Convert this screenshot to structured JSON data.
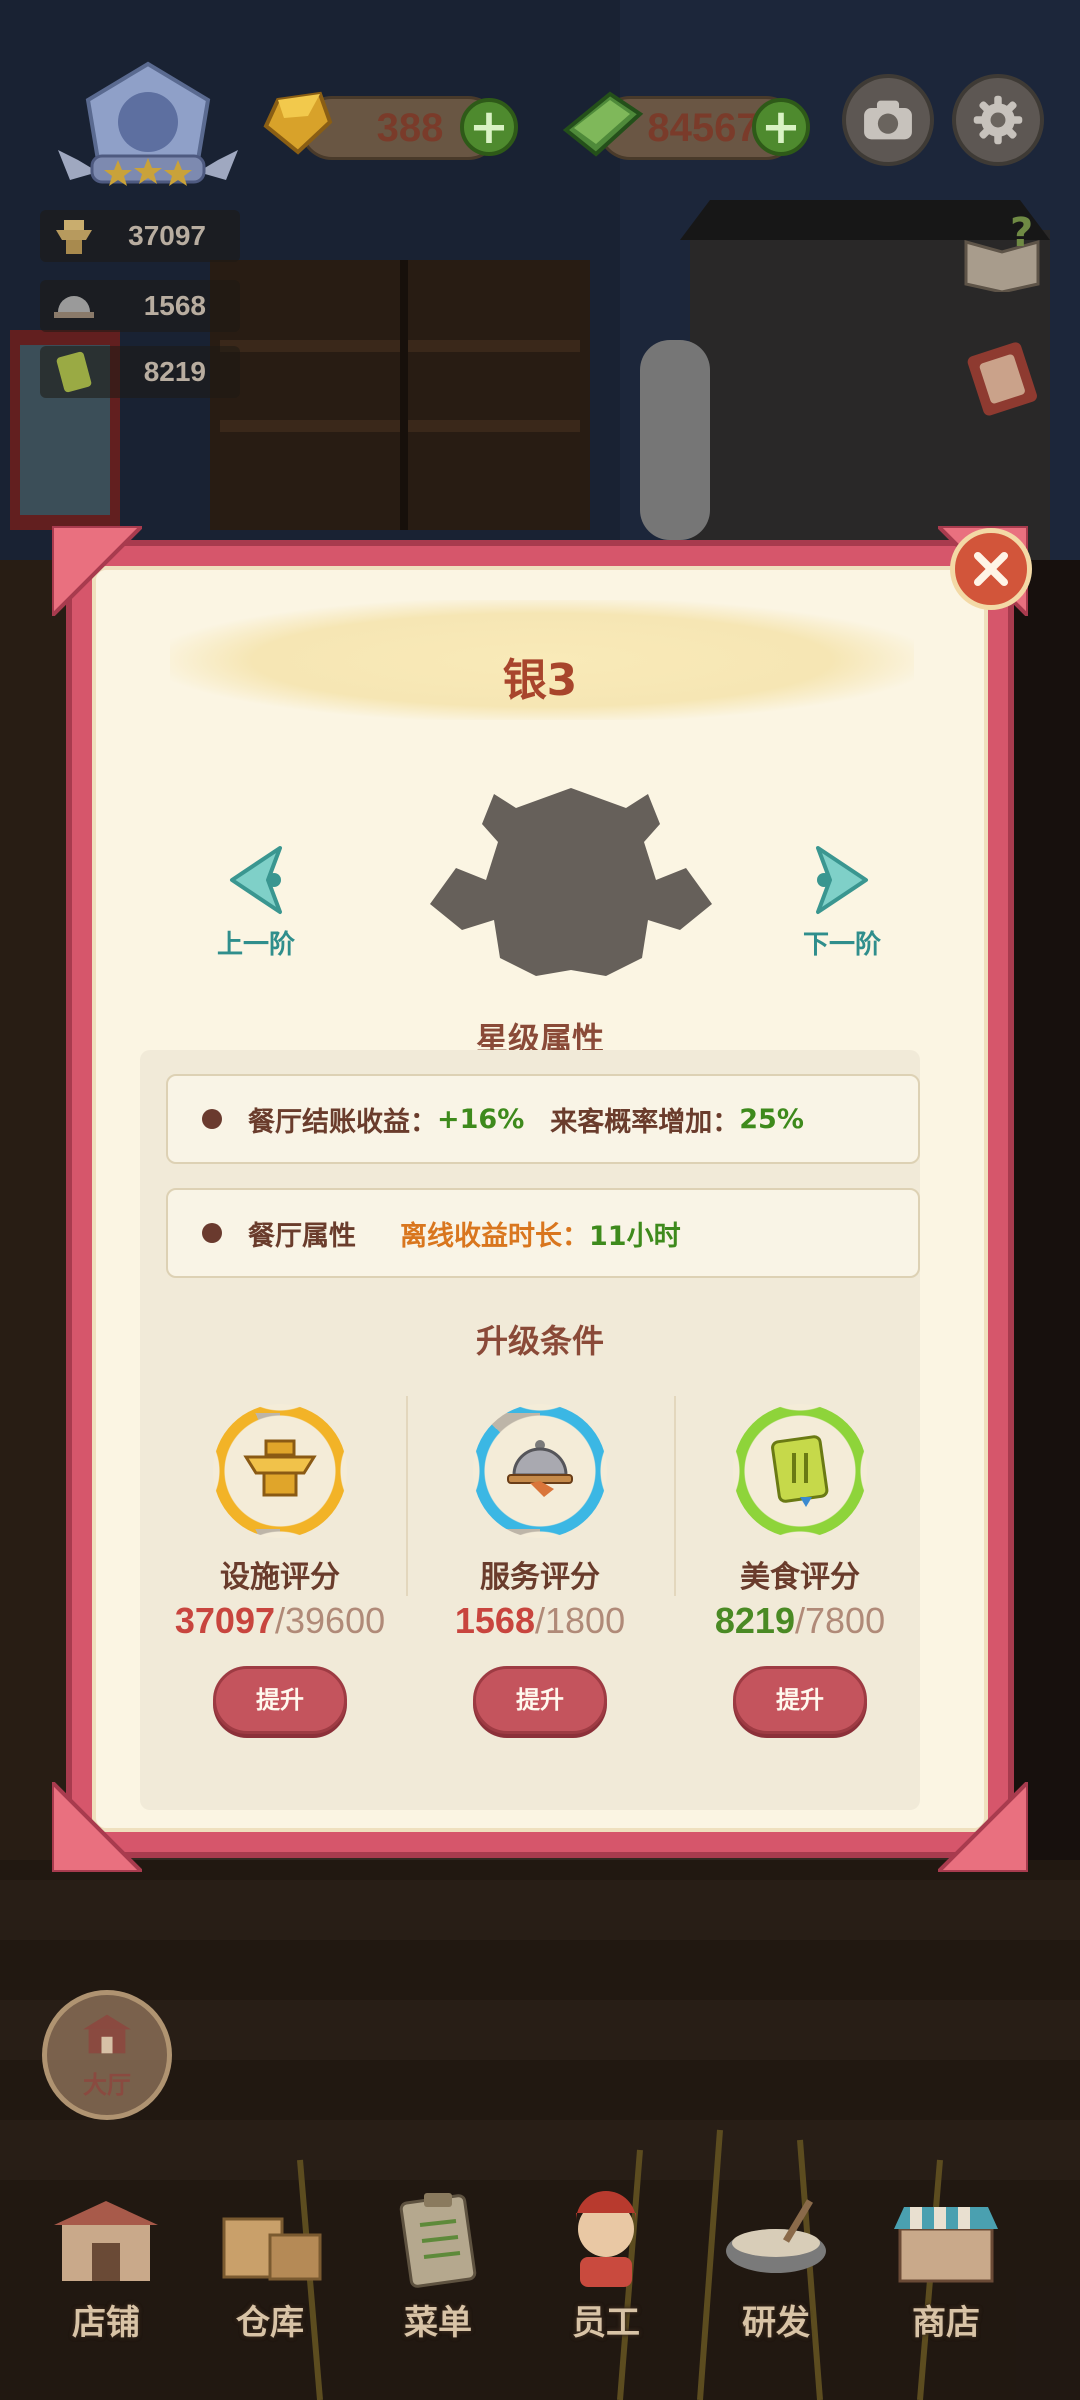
{
  "hud": {
    "gold": "388",
    "cash": "84567"
  },
  "stats": {
    "facility": "37097",
    "service": "1568",
    "food": "8219"
  },
  "modal": {
    "title": "银3",
    "prev_label": "上一阶",
    "next_label": "下一阶",
    "star_attr_title": "星级属性",
    "attr_row1": {
      "label": "餐厅结账收益：",
      "value": "+16%",
      "label2": "来客概率增加：",
      "value2": "25%"
    },
    "attr_row2": {
      "label": "餐厅属性",
      "sub_label": "离线收益时长：",
      "value": "11小时"
    },
    "upgrade_title": "升级条件",
    "conditions": [
      {
        "label": "设施评分",
        "current": "37097",
        "required": "39600",
        "current_color": "#c8453e",
        "progress": 0.937
      },
      {
        "label": "服务评分",
        "current": "1568",
        "required": "1800",
        "current_color": "#c8453e",
        "progress": 0.871
      },
      {
        "label": "美食评分",
        "current": "8219",
        "required": "7800",
        "current_color": "#4a8a24",
        "progress": 1.0
      }
    ],
    "upgrade_button": "提升"
  },
  "hall_label": "大厅",
  "tabs": [
    "店铺",
    "仓库",
    "菜单",
    "员工",
    "研发",
    "商店"
  ],
  "icons": {
    "level_badge": "chef-hat-badge-icon",
    "gold": "gold-ingot-icon",
    "cash": "cash-bundle-icon",
    "camera": "camera-icon",
    "settings": "gear-icon",
    "help": "help-book-icon",
    "close": "close-icon"
  },
  "colors": {
    "frame": "#d6566b",
    "panel": "#fbf5e3",
    "accent_teal": "#2f8e8c",
    "ring_facility": "#f2b327",
    "ring_service": "#3bb7e4",
    "ring_food": "#8ed43a"
  }
}
